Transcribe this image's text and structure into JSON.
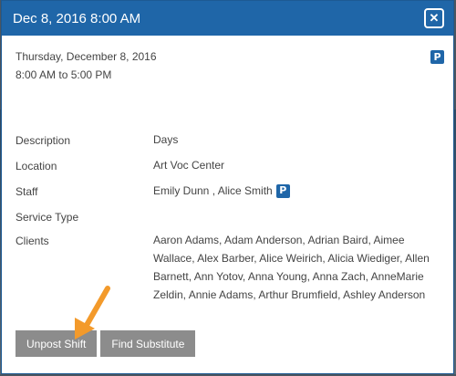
{
  "modal": {
    "title": "Dec 8, 2016 8:00 AM",
    "close_glyph": "✕"
  },
  "shift": {
    "date": "Thursday, December 8, 2016",
    "time_range": "8:00 AM to 5:00 PM",
    "badge": "P"
  },
  "details": {
    "description_label": "Description",
    "description_value": "Days",
    "location_label": "Location",
    "location_value": "Art Voc Center",
    "staff_label": "Staff",
    "staff_value": "Emily Dunn , Alice Smith",
    "staff_badge": "P",
    "service_type_label": "Service Type",
    "service_type_value": "",
    "clients_label": "Clients",
    "clients_value": "Aaron Adams, Adam Anderson, Adrian Baird, Aimee Wallace, Alex Barber, Alice Weirich, Alicia Wiediger, Allen Barnett, Ann Yotov, Anna Young, Anna Zach, AnneMarie Zeldin, Annie Adams, Arthur Brumfield, Ashley Anderson"
  },
  "buttons": {
    "unpost": "Unpost Shift",
    "find_substitute": "Find Substitute"
  },
  "colors": {
    "header": "#1f66a8",
    "button": "#8c8c8c",
    "arrow": "#f39a2b"
  },
  "icons": {
    "close": "close-icon",
    "posted": "posted-badge-icon",
    "arrow": "annotation-arrow"
  }
}
